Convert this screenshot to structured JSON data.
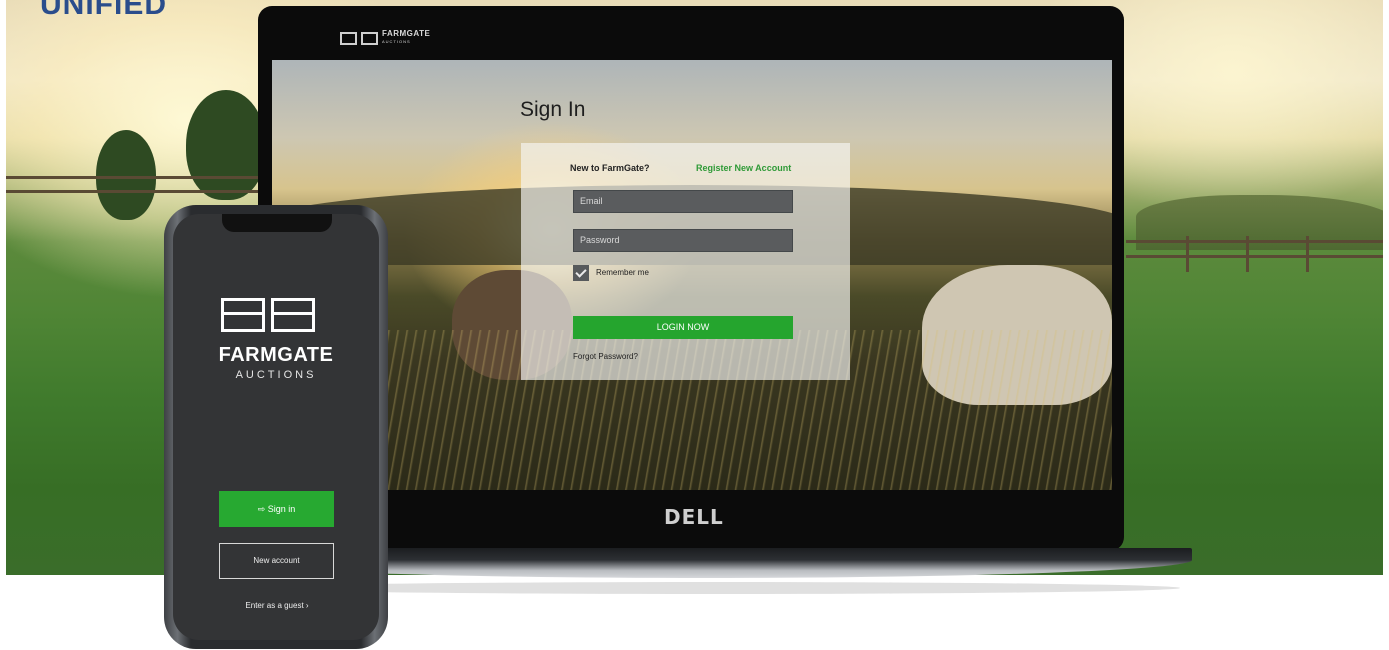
{
  "page": {
    "headline": "UNIFIED"
  },
  "laptop": {
    "header_logo_text": "FARMGATE",
    "header_logo_sub": "AUCTIONS",
    "sign_in_title": "Sign In",
    "new_to_label": "New to FarmGate?",
    "register_link": "Register New Account",
    "email_placeholder": "Email",
    "password_placeholder": "Password",
    "remember_me_label": "Remember me",
    "remember_me_checked": true,
    "login_button": "LOGIN NOW",
    "forgot_password_link": "Forgot Password?",
    "brand_bezel": "DELL",
    "accent_green": "#25a52e"
  },
  "phone": {
    "app_name": "FARMGATE",
    "app_sub": "AUCTIONS",
    "sign_in_button": "Sign in",
    "sign_in_icon": "login-arrow-icon",
    "new_account_button": "New account",
    "guest_link": "Enter as a guest ›"
  }
}
